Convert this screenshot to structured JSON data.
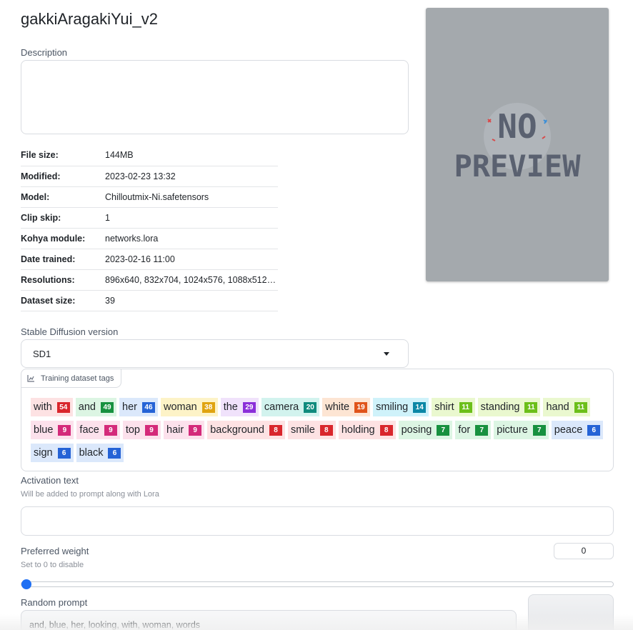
{
  "page": {
    "title": "gakkiAragakiYui_v2"
  },
  "description": {
    "label": "Description",
    "value": ""
  },
  "info": [
    {
      "key": "File size:",
      "value": "144MB"
    },
    {
      "key": "Modified:",
      "value": "2023-02-23 13:32"
    },
    {
      "key": "Model:",
      "value": "Chilloutmix-Ni.safetensors"
    },
    {
      "key": "Clip skip:",
      "value": "1"
    },
    {
      "key": "Kohya module:",
      "value": "networks.lora"
    },
    {
      "key": "Date trained:",
      "value": "2023-02-16 11:00"
    },
    {
      "key": "Resolutions:",
      "value": "896x640, 832x704, 1024x576, 1088x512, ..."
    },
    {
      "key": "Dataset size:",
      "value": "39"
    }
  ],
  "preview": {
    "line1": "NO",
    "line2": "PREVIEW"
  },
  "sd_version": {
    "label": "Stable Diffusion version",
    "value": "SD1"
  },
  "tags_panel": {
    "header": "Training dataset tags",
    "tags": [
      {
        "name": "with",
        "count": "54",
        "bg": "#fde2e3",
        "badge": "#d9262c"
      },
      {
        "name": "and",
        "count": "49",
        "bg": "#dcf5e3",
        "badge": "#17913f"
      },
      {
        "name": "her",
        "count": "46",
        "bg": "#dbe8fb",
        "badge": "#2563d6"
      },
      {
        "name": "woman",
        "count": "38",
        "bg": "#fdf3c7",
        "badge": "#e0a410"
      },
      {
        "name": "the",
        "count": "29",
        "bg": "#f0e2fb",
        "badge": "#8b2fd9"
      },
      {
        "name": "camera",
        "count": "20",
        "bg": "#d2f3ee",
        "badge": "#0f8b7d"
      },
      {
        "name": "white",
        "count": "19",
        "bg": "#fde5d3",
        "badge": "#e0541a"
      },
      {
        "name": "smiling",
        "count": "14",
        "bg": "#cff2fa",
        "badge": "#0b87a6"
      },
      {
        "name": "shirt",
        "count": "11",
        "bg": "#eaf8cf",
        "badge": "#6cbf1a"
      },
      {
        "name": "standing",
        "count": "11",
        "bg": "#eaf8cf",
        "badge": "#6cbf1a"
      },
      {
        "name": "hand",
        "count": "11",
        "bg": "#eaf8cf",
        "badge": "#6cbf1a"
      },
      {
        "name": "blue",
        "count": "9",
        "bg": "#fce1ec",
        "badge": "#d42a7a"
      },
      {
        "name": "face",
        "count": "9",
        "bg": "#fce1ec",
        "badge": "#d42a7a"
      },
      {
        "name": "top",
        "count": "9",
        "bg": "#fce1ec",
        "badge": "#d42a7a"
      },
      {
        "name": "hair",
        "count": "9",
        "bg": "#fce1ec",
        "badge": "#d42a7a"
      },
      {
        "name": "background",
        "count": "8",
        "bg": "#fde2e3",
        "badge": "#d9262c"
      },
      {
        "name": "smile",
        "count": "8",
        "bg": "#fde2e3",
        "badge": "#d9262c"
      },
      {
        "name": "holding",
        "count": "8",
        "bg": "#fde2e3",
        "badge": "#d9262c"
      },
      {
        "name": "posing",
        "count": "7",
        "bg": "#dcf5e3",
        "badge": "#17913f"
      },
      {
        "name": "for",
        "count": "7",
        "bg": "#dcf5e3",
        "badge": "#17913f"
      },
      {
        "name": "picture",
        "count": "7",
        "bg": "#dcf5e3",
        "badge": "#17913f"
      },
      {
        "name": "peace",
        "count": "6",
        "bg": "#dbe8fb",
        "badge": "#2563d6"
      },
      {
        "name": "sign",
        "count": "6",
        "bg": "#dbe8fb",
        "badge": "#2563d6"
      },
      {
        "name": "black",
        "count": "6",
        "bg": "#dbe8fb",
        "badge": "#2563d6"
      }
    ]
  },
  "activation": {
    "label": "Activation text",
    "hint": "Will be added to prompt along with Lora",
    "value": ""
  },
  "weight": {
    "label": "Preferred weight",
    "hint": "Set to 0 to disable",
    "value": "0",
    "slider_fraction": 0
  },
  "random_prompt": {
    "label": "Random prompt",
    "value": "and, blue, her, looking, with, woman, words"
  }
}
